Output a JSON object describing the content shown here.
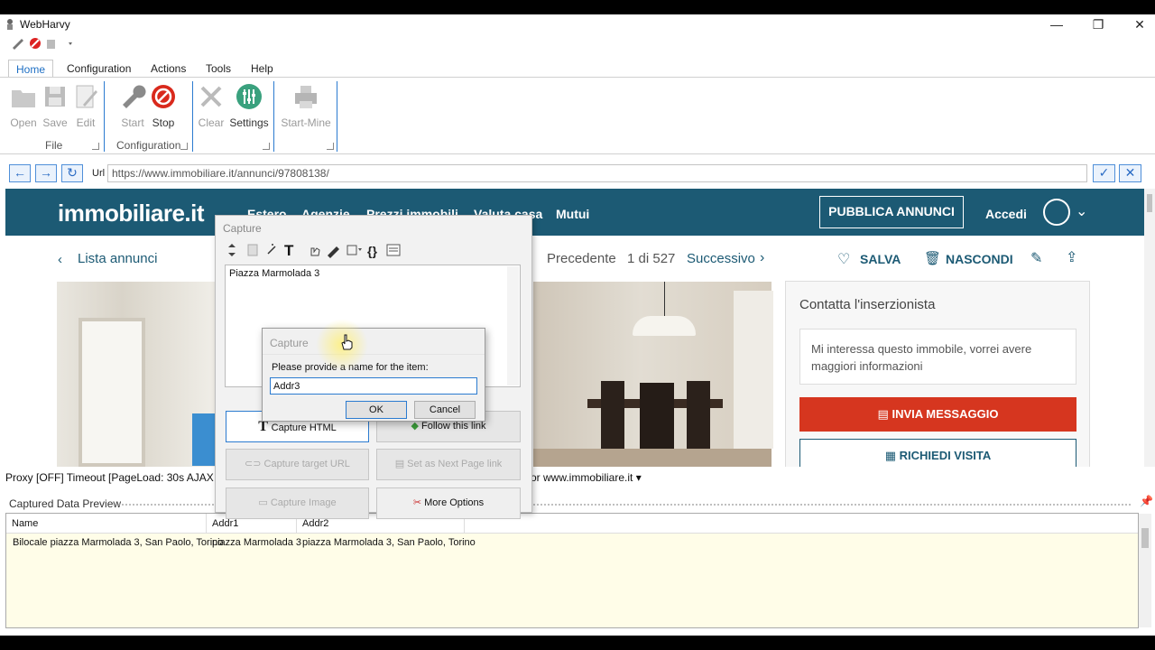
{
  "window": {
    "title": "WebHarvy"
  },
  "menu": {
    "tabs": [
      "Home",
      "Configuration",
      "Actions",
      "Tools",
      "Help"
    ],
    "active": "Home"
  },
  "ribbon": {
    "file": {
      "label": "File",
      "buttons": [
        "Open",
        "Save",
        "Edit"
      ]
    },
    "configuration": {
      "label": "Configuration",
      "buttons": [
        "Start",
        "Stop"
      ]
    },
    "settings": {
      "buttons": [
        "Clear",
        "Settings"
      ]
    },
    "mine": {
      "buttons": [
        "Start-Mine"
      ]
    }
  },
  "urlbar": {
    "label": "Url",
    "value": "https://www.immobiliare.it/annunci/97808138/"
  },
  "site": {
    "logo": "immobiliare.it",
    "nav": [
      "Estero",
      "Agenzie",
      "Prezzi immobili",
      "Valuta casa",
      "Mutui"
    ],
    "publish": "PUBBLICA ANNUNCI",
    "login": "Accedi",
    "back": "Lista annunci",
    "prev": "Precedente",
    "pager": "1 di 527",
    "next": "Successivo",
    "save": "SALVA",
    "hide": "NASCONDI",
    "contact_title": "Contatta l'inserzionista",
    "message": "Mi interessa questo immobile, vorrei avere maggiori informazioni",
    "send": "INVIA MESSAGGIO",
    "visit": "RICHIEDI VISITA"
  },
  "status": {
    "left": "Proxy [OFF] Timeout [PageLoad: 30s AJAX 5s]",
    "right": "or www.immobiliare.it ▾"
  },
  "preview": {
    "title": "Captured Data Preview",
    "columns": [
      "Name",
      "Addr1",
      "Addr2"
    ],
    "rows": [
      [
        "Bilocale piazza Marmolada 3, San Paolo, Torino",
        "piazza Marmolada 3",
        "piazza Marmolada 3, San Paolo, Torino"
      ]
    ]
  },
  "capture": {
    "title": "Capture",
    "text": "Piazza Marmolada 3",
    "buttons": {
      "capture_html": "Capture HTML",
      "follow_link": "Follow this link",
      "capture_target": "Capture target URL",
      "next_page": "Set as Next Page link",
      "capture_image": "Capture Image",
      "more_options": "More Options"
    }
  },
  "name_dialog": {
    "title": "Capture",
    "prompt": "Please provide a name for the item:",
    "value": "Addr3",
    "ok": "OK",
    "cancel": "Cancel"
  },
  "colors": {
    "site_header": "#1c5a74",
    "send_button": "#d6361f",
    "accent": "#2b7bd0"
  }
}
